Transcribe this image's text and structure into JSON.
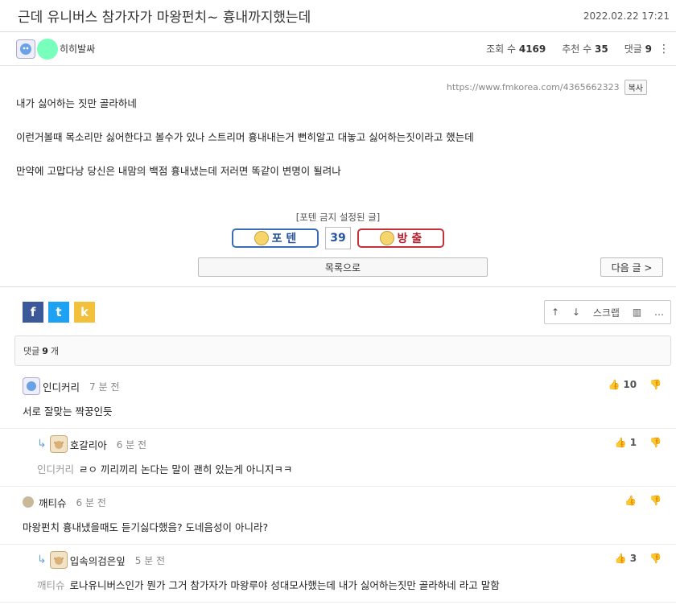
{
  "post": {
    "title": "근데 유니버스 참가자가 마왕펀치~ 흉내까지했는데",
    "date": "2022.02.22 17:21",
    "author": "히히발싸",
    "views_label": "조회 수",
    "views": "4169",
    "recommend_label": "추천 수",
    "recommend": "35",
    "comments_label": "댓글",
    "comments": "9",
    "url": "https://www.fmkorea.com/4365662323",
    "copy_label": "복사",
    "paragraphs": [
      "내가 싫어하는 짓만 골라하네",
      "이런거볼때 목소리만 싫어한다고 볼수가 있나 스트리머 흉내내는거 뻔히알고 대놓고 싫어하는짓이라고 했는데",
      "만약에 고맙다낭 당신은 내맘의 백점 흉내냈는데 저러면 똑같이 변명이 될려나"
    ]
  },
  "vote": {
    "caption": "[포텐 금지 설정된 글]",
    "up_label": "포 텐",
    "count": "39",
    "down_label": "방 출"
  },
  "nav": {
    "list_label": "목록으로",
    "next_label": "다음 글 >"
  },
  "share": {
    "facebook": "f",
    "twitter": "t",
    "kakao": "k",
    "scrap_label": "스크랩",
    "icons": [
      "arrow-up-icon",
      "arrow-down-icon",
      "chart-icon",
      "more-icon"
    ]
  },
  "comment_summary": {
    "label": "댓글",
    "count": "9",
    "unit": "개"
  },
  "comments": [
    {
      "nick": "인디커리",
      "time": "7 분 전",
      "likes": "10",
      "body": "서로 잘맞는 짝꿍인듯",
      "reply": false,
      "avatar": "icon",
      "mention": ""
    },
    {
      "nick": "호갈리아",
      "time": "6 분 전",
      "likes": "1",
      "body": "ㄹㅇ 끼리끼리 논다는 말이 괜히 있는게 아니지ㅋㅋ",
      "reply": true,
      "avatar": "dog",
      "mention": "인디커리"
    },
    {
      "nick": "깨티슈",
      "time": "6 분 전",
      "likes": "",
      "body": "마왕펀치 흉내냈을때도 듣기싫다했음? 도네음성이 아니라?",
      "reply": false,
      "avatar": "dot",
      "mention": ""
    },
    {
      "nick": "입속의검은잎",
      "time": "5 분 전",
      "likes": "3",
      "body": "로나유니버스인가 뭔가 그거 참가자가 마왕루야 성대모사했는데 내가 싫어하는짓만 골라하네 라고 말함",
      "reply": true,
      "avatar": "dog",
      "mention": "깨티슈"
    }
  ],
  "colors": {
    "up": "#3a6fb7",
    "down": "#c3313c",
    "facebook": "#3b5998",
    "twitter": "#1da1f2",
    "kakao": "#f2c03a"
  }
}
